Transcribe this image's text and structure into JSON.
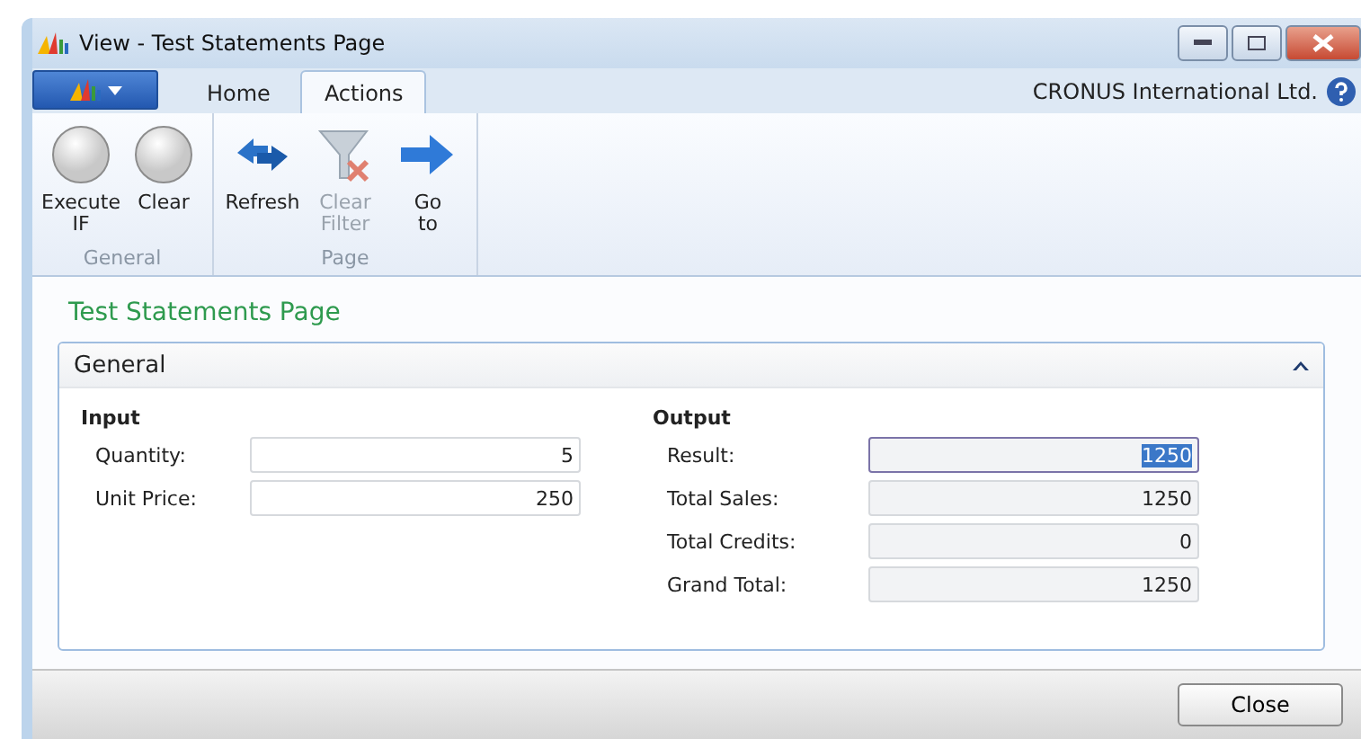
{
  "window": {
    "title": "View - Test Statements Page"
  },
  "tabs": [
    {
      "label": "Home",
      "selected": false
    },
    {
      "label": "Actions",
      "selected": true
    }
  ],
  "company": "CRONUS International Ltd.",
  "ribbon": [
    {
      "group": "General",
      "buttons": [
        {
          "label": "Execute IF",
          "kind": "circle",
          "disabled": false
        },
        {
          "label": "Clear",
          "kind": "circle",
          "disabled": false
        }
      ]
    },
    {
      "group": "Page",
      "buttons": [
        {
          "label": "Refresh",
          "kind": "refresh",
          "disabled": false
        },
        {
          "label": "Clear Filter",
          "kind": "filter",
          "disabled": true
        },
        {
          "label": "Go to",
          "kind": "arrow",
          "disabled": false
        }
      ]
    }
  ],
  "page_title": "Test Statements Page",
  "section": {
    "title": "General",
    "expanded": true,
    "groups": [
      {
        "heading": "Input",
        "fields": [
          {
            "label": "Quantity:",
            "value": "5",
            "readonly": false,
            "focused": false
          },
          {
            "label": "Unit Price:",
            "value": "250",
            "readonly": false,
            "focused": false
          }
        ]
      },
      {
        "heading": "Output",
        "fields": [
          {
            "label": "Result:",
            "value": "1250",
            "readonly": true,
            "focused": true
          },
          {
            "label": "Total Sales:",
            "value": "1250",
            "readonly": true,
            "focused": false
          },
          {
            "label": "Total Credits:",
            "value": "0",
            "readonly": true,
            "focused": false
          },
          {
            "label": "Grand Total:",
            "value": "1250",
            "readonly": true,
            "focused": false
          }
        ]
      }
    ]
  },
  "buttons": [
    "Close"
  ]
}
